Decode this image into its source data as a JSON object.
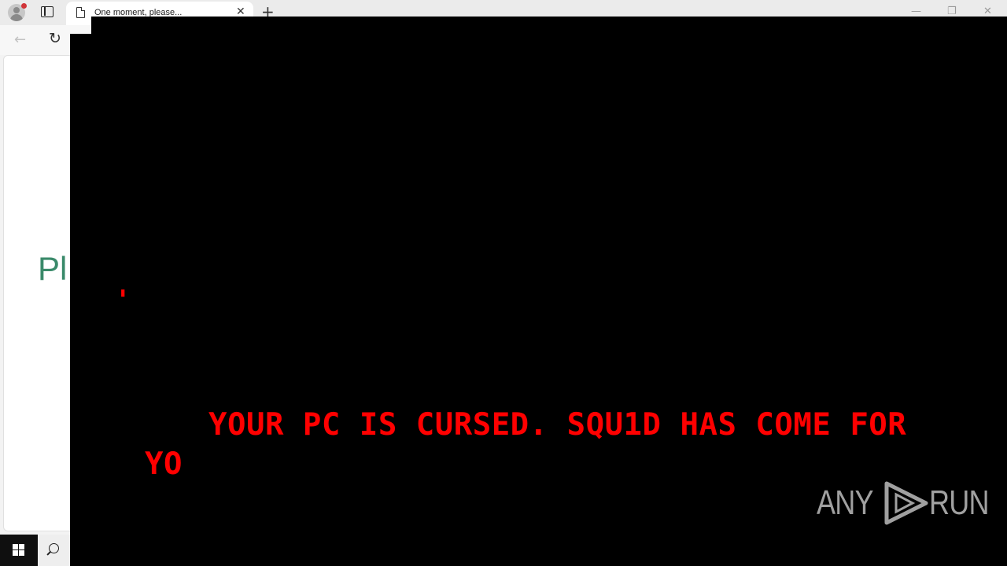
{
  "browser": {
    "tab_title": "One moment, please...",
    "tab_close": "✕",
    "new_tab": "+",
    "back_glyph": "←",
    "refresh_glyph": "↻",
    "minimize_glyph": "—",
    "restore_glyph": "❐",
    "close_glyph": "✕",
    "page_partial_text": "Pl"
  },
  "overlay": {
    "red_fragment": "'",
    "message_line1": "YOUR PC IS CURSED. SQU1D HAS COME FOR",
    "message_line2": "YO",
    "text_color": "#ff0000",
    "background": "#000000"
  },
  "watermark": {
    "left": "ANY",
    "right": "RUN"
  },
  "icons": [
    "profile-icon",
    "tab-actions-icon",
    "document-icon",
    "close-icon",
    "plus-icon",
    "back-arrow-icon",
    "refresh-icon",
    "windows-logo-icon",
    "search-icon",
    "play-triangle-icon"
  ]
}
